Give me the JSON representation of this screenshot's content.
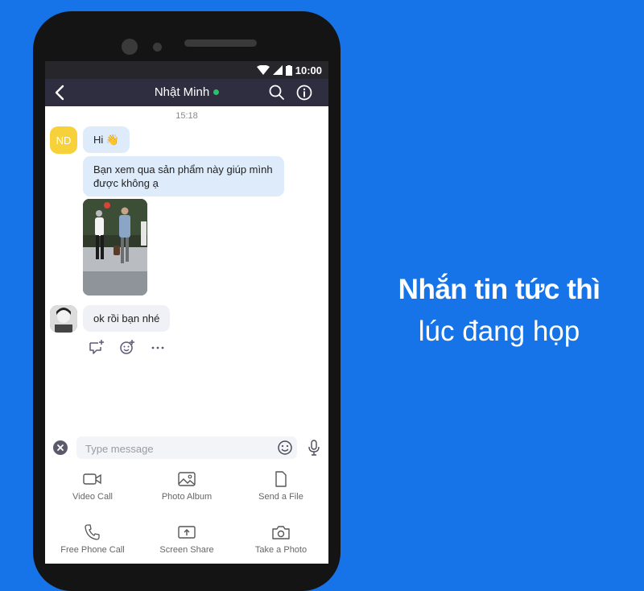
{
  "status_bar": {
    "time": "10:00"
  },
  "chat_header": {
    "title": "Nhật Minh",
    "online": true
  },
  "messages": {
    "timestamp": "15:18",
    "sender_initials": "ND",
    "items": [
      {
        "text": "Hi 👋"
      },
      {
        "text": "Bạn xem qua sản phẩm này giúp mình được không ạ"
      },
      {
        "type": "image",
        "alt": "photo of two men walking"
      },
      {
        "text": "ok rồi bạn nhé"
      }
    ]
  },
  "composer": {
    "placeholder": "Type message",
    "value": ""
  },
  "actions": [
    {
      "label": "Video Call",
      "icon": "video-icon"
    },
    {
      "label": "Photo Album",
      "icon": "image-icon"
    },
    {
      "label": "Send a File",
      "icon": "file-icon"
    },
    {
      "label": "Free Phone Call",
      "icon": "phone-icon"
    },
    {
      "label": "Screen Share",
      "icon": "screen-share-icon"
    },
    {
      "label": "Take a Photo",
      "icon": "camera-icon"
    }
  ],
  "promo": {
    "line1": "Nhắn tin tức thì",
    "line2": "lúc đang họp"
  },
  "colors": {
    "background": "#1773e8",
    "header": "#2e2e40",
    "bubble_incoming": "#ddebfb",
    "online": "#2dbf6c"
  }
}
